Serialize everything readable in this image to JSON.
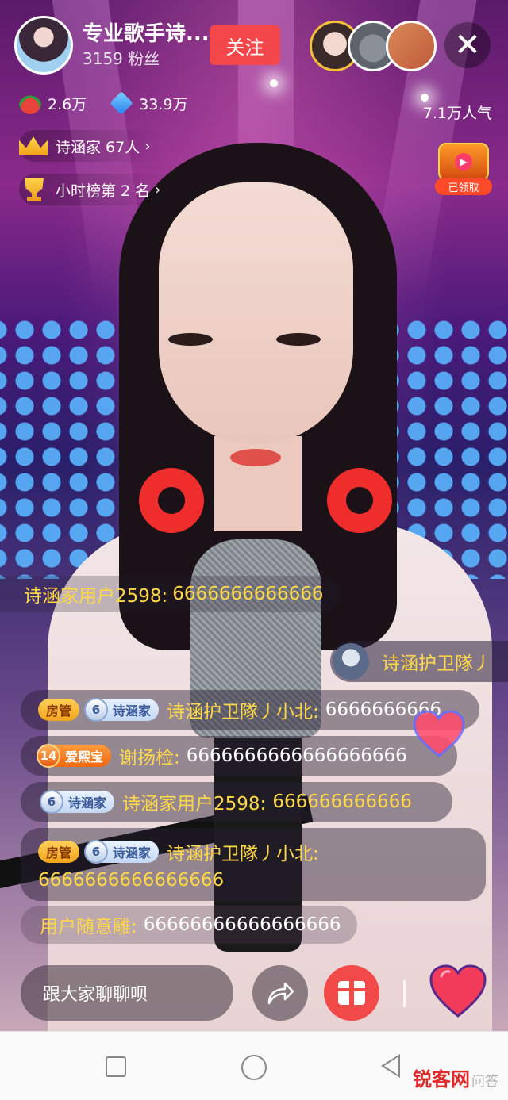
{
  "anchor": {
    "name": "专业歌手诗...",
    "fans": "3159 粉丝",
    "follow_label": "关注"
  },
  "viewers": [
    "viewer-1",
    "viewer-2",
    "viewer-3"
  ],
  "stats": {
    "melons": "2.6万",
    "diamonds": "33.9万",
    "popularity": "7.1万人气"
  },
  "fan_club": {
    "label": "诗涵家 67人",
    "chevron": "›"
  },
  "hour_rank": {
    "label": "小时榜第 2 名",
    "chevron": "›"
  },
  "treasure": {
    "status": "已领取"
  },
  "entry_notice": {
    "text": "诗涵护卫隊丿"
  },
  "top_message": {
    "user": "诗涵家用户2598:",
    "text": "6666666666666"
  },
  "chat": [
    {
      "admin_badge": "房管",
      "fan_level": "6",
      "fan_name": "诗涵家",
      "user": "诗涵护卫隊丿小北:",
      "text": "6666666666"
    },
    {
      "fan_level": "14",
      "fan_name": "爱熙宝",
      "user": "谢扬检:",
      "text": "6666666666666666666"
    },
    {
      "fan_level": "6",
      "fan_name": "诗涵家",
      "user": "诗涵家用户2598:",
      "text": "666666666666"
    },
    {
      "admin_badge": "房管",
      "fan_level": "6",
      "fan_name": "诗涵家",
      "user": "诗涵护卫隊丿小北:",
      "text": "6666666666666666"
    },
    {
      "user": "用户随意雕:",
      "text": "66666666666666666"
    }
  ],
  "bottom": {
    "chat_placeholder": "跟大家聊聊呗"
  },
  "watermark": {
    "main": "锐客网",
    "sub": "问答"
  },
  "colors": {
    "follow": "#f4474b",
    "username": "#ffd84a",
    "gift": "#f24a48"
  }
}
